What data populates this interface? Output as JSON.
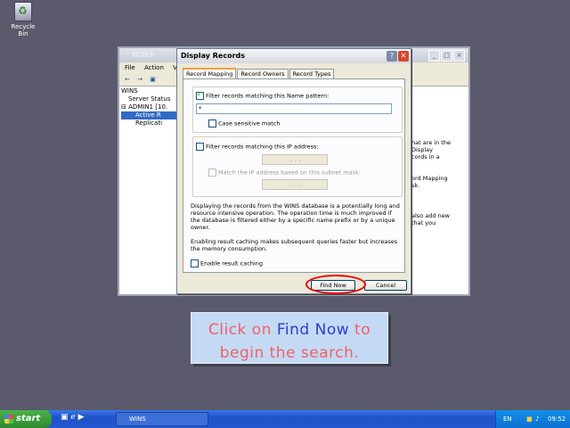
{
  "desktop": {
    "recycle_bin": "Recycle Bin"
  },
  "wins_window": {
    "title": "WINS",
    "menu": [
      "File",
      "Action",
      "Vie"
    ],
    "tree": [
      "WINS",
      "Server Status",
      "ADMIN1 [10.",
      "Active R",
      "Replicati"
    ],
    "right_text": [
      "hat are in the",
      "Display",
      "cords in a",
      "ord Mapping",
      "sk.",
      "also add new",
      "that you"
    ]
  },
  "dialog": {
    "title": "Display Records",
    "help": "?",
    "close": "✕",
    "tabs": [
      "Record Mapping",
      "Record Owners",
      "Record Types"
    ],
    "filter_name": {
      "label": "Filter records matching this Name pattern:",
      "checked": true,
      "value": "*"
    },
    "case_sensitive": {
      "label": "Case sensitive match",
      "checked": false
    },
    "filter_ip": {
      "label": "Filter records matching this IP address:",
      "checked": false,
      "value": ". . ."
    },
    "subnet": {
      "label": "Match the IP address based on this subnet mask:",
      "checked": false,
      "value": ". . ."
    },
    "info1": "Displaying the records from the WINS database is a potentially long and resource intensive operation. The operation time is much improved if the database is filtered either by a specific name prefix or by a unique owner.",
    "info2": "Enabling result caching makes subsequent queries faster but increases the memory consumption.",
    "cache": {
      "label": "Enable result caching",
      "checked": false
    },
    "find_now": "Find Now",
    "cancel": "Cancel"
  },
  "callout": {
    "part1": "Click on ",
    "part2": "Find Now",
    "part3": " to",
    "line2": "begin the search."
  },
  "taskbar": {
    "start": "start",
    "task": "WINS",
    "lang": "EN",
    "clock": "09:52"
  }
}
